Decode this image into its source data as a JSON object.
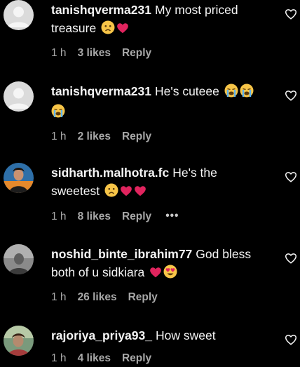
{
  "comments": [
    {
      "username": "tanishqverma231",
      "text": "My most priced treasure",
      "emojis": [
        "sad-face",
        "red-heart"
      ],
      "time": "1 h",
      "likes": "3 likes",
      "reply": "Reply",
      "avatar": "default-avatar"
    },
    {
      "username": "tanishqverma231",
      "text": "He's cuteee",
      "emojis": [
        "crying-face",
        "crying-face",
        "crying-face"
      ],
      "time": "1 h",
      "likes": "2 likes",
      "reply": "Reply",
      "avatar": "default-avatar"
    },
    {
      "username": "sidharth.malhotra.fc",
      "text": "He's the sweetest",
      "emojis": [
        "sad-face",
        "red-heart",
        "red-heart"
      ],
      "time": "1 h",
      "likes": "8 likes",
      "reply": "Reply",
      "more": "•••",
      "avatar": "photo-avatar"
    },
    {
      "username": "noshid_binte_ibrahim77",
      "text": "God bless both of u sidkiara",
      "emojis": [
        "red-heart",
        "heart-eyes-face"
      ],
      "time": "1 h",
      "likes": "26 likes",
      "reply": "Reply",
      "avatar": "photo-avatar"
    },
    {
      "username": "rajoriya_priya93_",
      "text": "How sweet",
      "emojis": [],
      "time": "1 h",
      "likes": "4 likes",
      "reply": "Reply",
      "avatar": "photo-avatar"
    }
  ],
  "colors": {
    "background": "#000000",
    "text": "#f5f5f5",
    "meta": "#a8a8a8",
    "heart": "#e0245e"
  }
}
